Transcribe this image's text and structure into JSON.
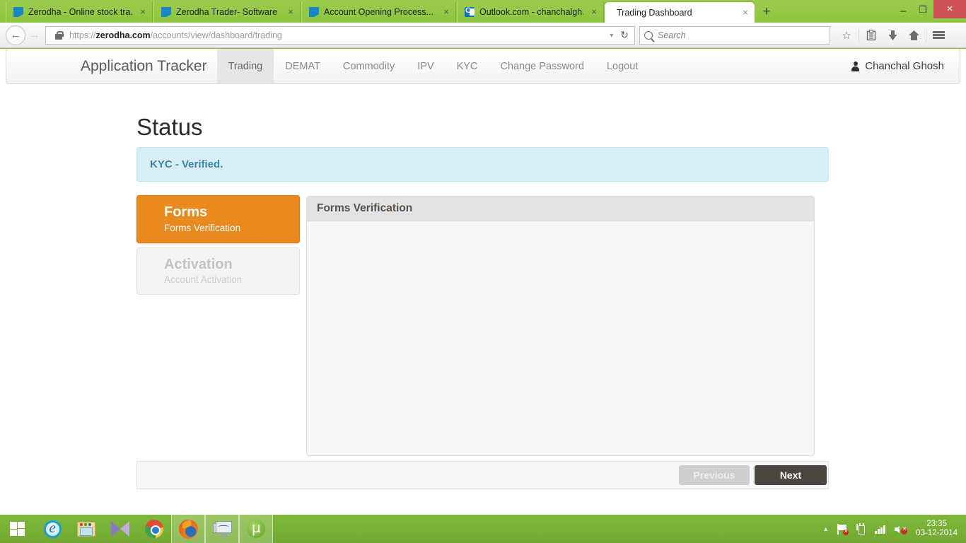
{
  "browser": {
    "tabs": [
      {
        "title": "Zerodha - Online stock tra...",
        "favicon": "zerodha-favicon",
        "active": false,
        "close": "×"
      },
      {
        "title": "Zerodha Trader- Software ...",
        "favicon": "zerodha-favicon",
        "active": false,
        "close": "×"
      },
      {
        "title": "Account Opening Process...",
        "favicon": "zerodha-favicon",
        "active": false,
        "close": "×"
      },
      {
        "title": "Outlook.com - chanchalgh...",
        "favicon": "outlook-favicon",
        "active": false,
        "close": "×"
      },
      {
        "title": "Trading Dashboard",
        "favicon": "none",
        "active": true,
        "close": "×"
      }
    ],
    "new_tab_label": "+",
    "window_controls": {
      "minimize": "–",
      "maximize": "❐",
      "close": "×"
    },
    "back_label": "←",
    "forward_label": "→",
    "url_scheme": "https://",
    "url_host": "zerodha.com",
    "url_path": "/accounts/view/dashboard/trading",
    "url_dropdown": "▼",
    "reload_label": "↻",
    "search_placeholder": "Search",
    "toolbar_icons": {
      "bookmark": "☆",
      "reader": "ὌB",
      "downloads": "⬇",
      "home": "⌂"
    }
  },
  "app": {
    "brand": "Application Tracker",
    "nav_items": [
      {
        "label": "Trading",
        "active": true
      },
      {
        "label": "DEMAT",
        "active": false
      },
      {
        "label": "Commodity",
        "active": false
      },
      {
        "label": "IPV",
        "active": false
      },
      {
        "label": "KYC",
        "active": false
      },
      {
        "label": "Change Password",
        "active": false
      },
      {
        "label": "Logout",
        "active": false
      }
    ],
    "user_name": "Chanchal Ghosh"
  },
  "page": {
    "title": "Status",
    "alert_text": "KYC - Verified.",
    "steps": [
      {
        "title": "Forms",
        "subtitle": "Forms Verification",
        "state": "active"
      },
      {
        "title": "Activation",
        "subtitle": "Account Activation",
        "state": "disabled"
      }
    ],
    "panel_header": "Forms Verification",
    "panel_body": "",
    "previous_label": "Previous",
    "next_label": "Next"
  },
  "taskbar": {
    "apps": [
      {
        "name": "start",
        "running": false
      },
      {
        "name": "internet-explorer",
        "running": false
      },
      {
        "name": "file-explorer",
        "running": false
      },
      {
        "name": "media-player",
        "running": false
      },
      {
        "name": "google-chrome",
        "running": false
      },
      {
        "name": "mozilla-firefox",
        "running": true
      },
      {
        "name": "system-monitor",
        "running": true
      },
      {
        "name": "utorrent",
        "running": true
      }
    ],
    "tray_expand": "▲",
    "clock_time": "23:35",
    "clock_date": "03-12-2014"
  },
  "colors": {
    "taskbar_green": "#7fb839",
    "browser_chrome_green": "#8cc63e",
    "accent_orange": "#ea8a1e",
    "alert_bg": "#d9edf7",
    "alert_text": "#3a87ad",
    "next_button": "#4c4641",
    "close_button_red": "#cd5356"
  }
}
